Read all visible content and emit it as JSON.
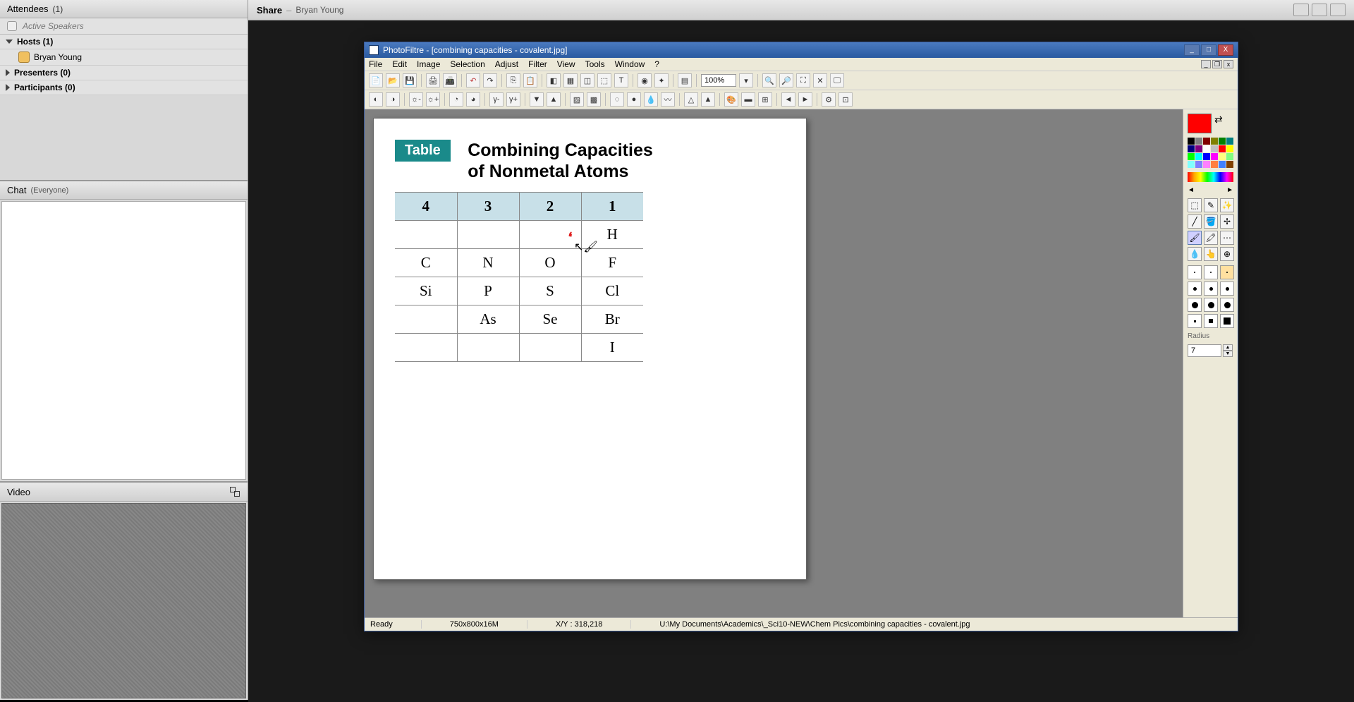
{
  "sidebar": {
    "attendees": {
      "title": "Attendees",
      "count": "(1)"
    },
    "active_speakers": "Active Speakers",
    "hosts": {
      "label": "Hosts (1)"
    },
    "host_name": "Bryan Young",
    "presenters": {
      "label": "Presenters (0)"
    },
    "participants": {
      "label": "Participants (0)"
    },
    "chat": {
      "title": "Chat",
      "scope": "(Everyone)"
    },
    "video": {
      "title": "Video"
    }
  },
  "share": {
    "title": "Share",
    "presenter": "Bryan Young"
  },
  "pf": {
    "title": "PhotoFiltre - [combining capacities - covalent.jpg]",
    "menu": [
      "File",
      "Edit",
      "Image",
      "Selection",
      "Adjust",
      "Filter",
      "View",
      "Tools",
      "Window",
      "?"
    ],
    "zoom": "100%",
    "doc": {
      "label": "Table",
      "title_line1": "Combining Capacities",
      "title_line2": "of Nonmetal Atoms",
      "headers": [
        "4",
        "3",
        "2",
        "1"
      ],
      "rows": [
        [
          "",
          "",
          "",
          "H"
        ],
        [
          "C",
          "N",
          "O",
          "F"
        ],
        [
          "Si",
          "P",
          "S",
          "Cl"
        ],
        [
          "",
          "As",
          "Se",
          "Br"
        ],
        [
          "",
          "",
          "",
          "I"
        ]
      ]
    },
    "palette": {
      "radius_label": "Radius",
      "radius": "7"
    },
    "status": {
      "ready": "Ready",
      "dims": "750x800x16M",
      "xy": "X/Y : 318,218",
      "path": "U:\\My Documents\\Academics\\_Sci10-NEW\\Chem Pics\\combining capacities - covalent.jpg"
    }
  },
  "colors": [
    "#000000",
    "#808080",
    "#800000",
    "#808000",
    "#008000",
    "#008080",
    "#000080",
    "#800080",
    "#ffffff",
    "#c0c0c0",
    "#ff0000",
    "#ffff00",
    "#00ff00",
    "#00ffff",
    "#0000ff",
    "#ff00ff",
    "#ffff80",
    "#80ff80",
    "#80ffff",
    "#8080ff",
    "#ff80ff",
    "#ff8040",
    "#4080ff",
    "#804000"
  ]
}
